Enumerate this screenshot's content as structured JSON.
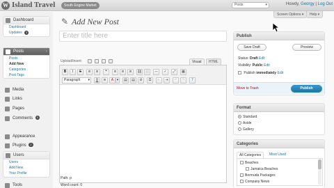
{
  "header": {
    "logo_glyph": "W",
    "site_title": "Island Travel",
    "visit_site": "South Engine Market",
    "favorites": "Posts",
    "howdy_prefix": "Howdy,",
    "user": "Georgy",
    "sep": "|",
    "logout": "Log Out"
  },
  "tabs": {
    "screen_options": "Screen Options ▾",
    "help": "Help ▾"
  },
  "sidebar": {
    "dashboard": "Dashboard",
    "dashboard_sub": [
      "Dashboard",
      "Updates"
    ],
    "updates_count": "3",
    "posts": "Posts",
    "posts_sub": [
      "Posts",
      "Add New",
      "Categories",
      "Post Tags"
    ],
    "media": "Media",
    "links": "Links",
    "pages": "Pages",
    "comments": "Comments",
    "comments_count": "0",
    "appearance": "Appearance",
    "plugins": "Plugins",
    "plugins_count": "2",
    "users": "Users",
    "users_sub": [
      "Users",
      "Add New",
      "Your Profile"
    ],
    "tools": "Tools"
  },
  "main": {
    "page_title": "Add New Post",
    "title_placeholder": "Enter title here",
    "upload_insert": "Upload/Insert",
    "tab_visual": "Visual",
    "tab_html": "HTML",
    "format_select": "Paragraph",
    "path": "Path: p",
    "word_count": "Word count: 0"
  },
  "toolbar_row1": [
    "B",
    "I",
    "S",
    "≡",
    "≡",
    "❝",
    "≡",
    "≡",
    "≡",
    "⛓",
    "⛓",
    "—",
    "✓",
    "▦",
    "⤢"
  ],
  "toolbar_row2": [
    "U",
    "≡",
    "A",
    "▾",
    "▤",
    "▤",
    "⊘",
    "Ω",
    "⇤",
    "⇥",
    "↶",
    "↷",
    "?"
  ],
  "publish": {
    "title": "Publish",
    "save_draft": "Save Draft",
    "preview": "Preview",
    "status_label": "Status:",
    "status": "Draft",
    "status_edit": "Edit",
    "visibility_label": "Visibility:",
    "visibility": "Public",
    "visibility_edit": "Edit",
    "publish_when": "Publish",
    "publish_when_value": "immediately",
    "publish_edit": "Edit",
    "move_to_trash": "Move to Trash",
    "publish_button": "Publish"
  },
  "format": {
    "title": "Format",
    "options": [
      "Standard",
      "Aside",
      "Gallery"
    ],
    "selected": "Standard"
  },
  "categories": {
    "title": "Categories",
    "tab_all": "All Categories",
    "tab_most_used": "Most Used",
    "items": [
      "Beaches",
      "Jamaica Beaches",
      "Bermuda Packages",
      "Company News"
    ]
  }
}
